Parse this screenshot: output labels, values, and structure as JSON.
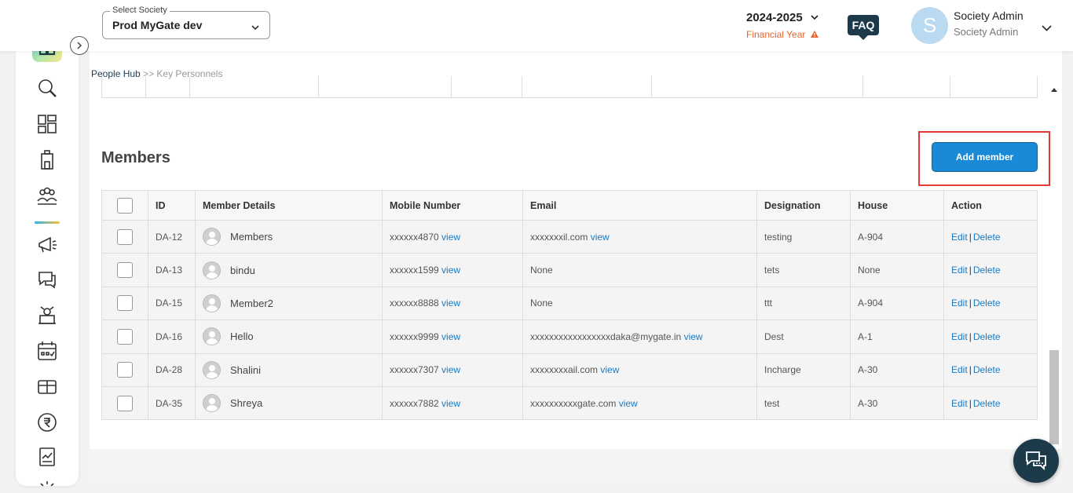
{
  "header": {
    "society_label": "Select Society",
    "society_value": "Prod MyGate dev",
    "year": "2024-2025",
    "fy_label": "Financial Year",
    "faq": "FAQ",
    "avatar_letter": "S",
    "user_name": "Society Admin",
    "user_role": "Society Admin"
  },
  "breadcrumb": {
    "root": "People Hub",
    "sep": ">>",
    "current": "Key Personnels"
  },
  "members": {
    "title": "Members",
    "add_button": "Add member",
    "columns": [
      "ID",
      "Member Details",
      "Mobile Number",
      "Email",
      "Designation",
      "House",
      "Action"
    ],
    "view_label": "view",
    "edit_label": "Edit",
    "delete_label": "Delete",
    "action_sep": "|",
    "rows": [
      {
        "id": "DA-12",
        "name": "Members",
        "mobile": "xxxxxx4870",
        "email": "xxxxxxxil.com",
        "email_view": true,
        "designation": "testing",
        "house": "A-904"
      },
      {
        "id": "DA-13",
        "name": "bindu",
        "mobile": "xxxxxx1599",
        "email": "None",
        "email_view": false,
        "designation": "tets",
        "house": "None"
      },
      {
        "id": "DA-15",
        "name": "Member2",
        "mobile": "xxxxxx8888",
        "email": "None",
        "email_view": false,
        "designation": "ttt",
        "house": "A-904"
      },
      {
        "id": "DA-16",
        "name": "Hello",
        "mobile": "xxxxxx9999",
        "email": "xxxxxxxxxxxxxxxxxdaka@mygate.in",
        "email_view": true,
        "designation": "Dest",
        "house": "A-1"
      },
      {
        "id": "DA-28",
        "name": "Shalini",
        "mobile": "xxxxxx7307",
        "email": "xxxxxxxxail.com",
        "email_view": true,
        "designation": "Incharge",
        "house": "A-30"
      },
      {
        "id": "DA-35",
        "name": "Shreya",
        "mobile": "xxxxxx7882",
        "email": "xxxxxxxxxxgate.com",
        "email_view": true,
        "designation": "test",
        "house": "A-30"
      }
    ]
  },
  "sidebar": {
    "icons": [
      "search-icon",
      "dashboard-icon",
      "building-icon",
      "people-icon",
      "announcement-icon",
      "chat-icon",
      "amenity-icon",
      "calendar-icon",
      "gift-icon",
      "rupee-icon",
      "report-icon",
      "settings-icon"
    ]
  },
  "colors": {
    "accent": "#1a8ad6",
    "brand_dark": "#1d3a4a",
    "warning": "#e8642c",
    "highlight": "#e53935"
  }
}
